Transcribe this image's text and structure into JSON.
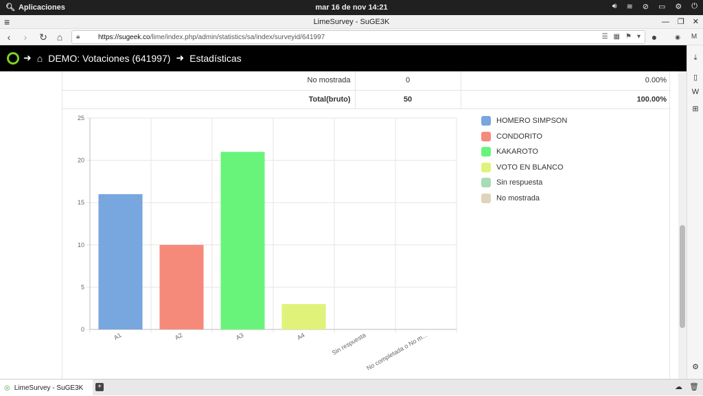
{
  "os": {
    "apps_label": "Aplicaciones",
    "clock": "mar 16 de nov     14:21"
  },
  "window": {
    "title": "LimeSurvey - SuGE3K"
  },
  "browser": {
    "url_host": "https://sugeek.co",
    "url_path": "/lime/index.php/admin/statistics/sa/index/surveyid/641997"
  },
  "header": {
    "survey": "DEMO: Votaciones (641997)",
    "section": "Estadísticas"
  },
  "table": {
    "rows": [
      {
        "label": "No mostrada",
        "count": "0",
        "percent": "0.00%"
      },
      {
        "label": "Total(bruto)",
        "count": "50",
        "percent": "100.00%"
      }
    ]
  },
  "chart_data": {
    "type": "bar",
    "categories": [
      "A1",
      "A2",
      "A3",
      "A4",
      "Sin respuesta",
      "No completada o No m..."
    ],
    "values": [
      16,
      10,
      21,
      3,
      0,
      0
    ],
    "colors": [
      "#78a6df",
      "#f58a7b",
      "#68f47b",
      "#e0f27a",
      "#a9dcb6",
      "#e0d3bb"
    ],
    "ylim": [
      0,
      25
    ],
    "yticks": [
      "0",
      "5",
      "10",
      "15",
      "20",
      "25"
    ],
    "legend": [
      "HOMERO SIMPSON",
      "CONDORITO",
      "KAKAROTO",
      "VOTO EN BLANCO",
      "Sin respuesta",
      "No mostrada"
    ],
    "legend_colors": [
      "#78a6df",
      "#f58a7b",
      "#68f47b",
      "#e0f27a",
      "#a9dcb6",
      "#e0d3bb"
    ],
    "grid": true,
    "legend_position": "right"
  },
  "taskbar": {
    "tab_label": "LimeSurvey - SuGE3K"
  }
}
